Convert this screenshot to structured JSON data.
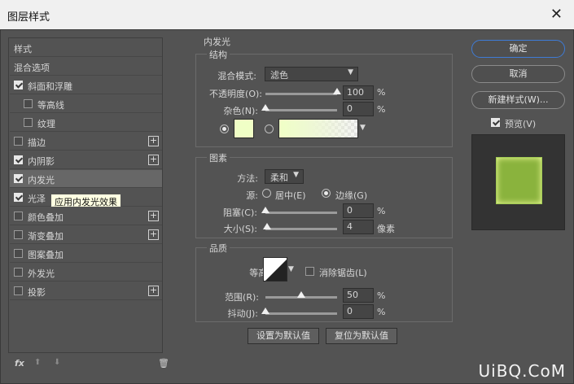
{
  "window": {
    "title": "图层样式",
    "close_glyph": "✕"
  },
  "sidebar": {
    "items": [
      {
        "label": "样式",
        "checkbox": false,
        "checked": false,
        "plus": false,
        "indent": 0,
        "selected": false
      },
      {
        "label": "混合选项",
        "checkbox": false,
        "checked": false,
        "plus": false,
        "indent": 0,
        "selected": false
      },
      {
        "label": "斜面和浮雕",
        "checkbox": true,
        "checked": true,
        "plus": false,
        "indent": 0,
        "selected": false
      },
      {
        "label": "等高线",
        "checkbox": true,
        "checked": false,
        "plus": false,
        "indent": 1,
        "selected": false
      },
      {
        "label": "纹理",
        "checkbox": true,
        "checked": false,
        "plus": false,
        "indent": 1,
        "selected": false
      },
      {
        "label": "描边",
        "checkbox": true,
        "checked": false,
        "plus": true,
        "indent": 0,
        "selected": false
      },
      {
        "label": "内阴影",
        "checkbox": true,
        "checked": true,
        "plus": true,
        "indent": 0,
        "selected": false
      },
      {
        "label": "内发光",
        "checkbox": true,
        "checked": true,
        "plus": false,
        "indent": 0,
        "selected": true
      },
      {
        "label": "光泽",
        "checkbox": true,
        "checked": true,
        "plus": false,
        "indent": 0,
        "selected": false
      },
      {
        "label": "颜色叠加",
        "checkbox": true,
        "checked": false,
        "plus": true,
        "indent": 0,
        "selected": false
      },
      {
        "label": "渐变叠加",
        "checkbox": true,
        "checked": false,
        "plus": true,
        "indent": 0,
        "selected": false
      },
      {
        "label": "图案叠加",
        "checkbox": true,
        "checked": false,
        "plus": false,
        "indent": 0,
        "selected": false
      },
      {
        "label": "外发光",
        "checkbox": true,
        "checked": false,
        "plus": false,
        "indent": 0,
        "selected": false
      },
      {
        "label": "投影",
        "checkbox": true,
        "checked": false,
        "plus": true,
        "indent": 0,
        "selected": false
      }
    ],
    "tooltip": "应用内发光效果",
    "bottom_icons": {
      "fx": "fx",
      "up": "⬆",
      "down": "⬇",
      "trash": "🗑"
    }
  },
  "inner_glow": {
    "section_title": "内发光",
    "structure": {
      "title": "结构",
      "blend_mode_label": "混合模式:",
      "blend_mode_value": "滤色",
      "opacity_label": "不透明度(O):",
      "opacity_value": "100",
      "opacity_level": 1.0,
      "noise_label": "杂色(N):",
      "noise_value": "0",
      "noise_level": 0.0,
      "percent": "%",
      "glow_color": "#f0ffc6"
    },
    "elements": {
      "title": "图素",
      "technique_label": "方法:",
      "technique_value": "柔和",
      "source_label": "源:",
      "source_center": "居中(E)",
      "source_edge": "边缘(G)",
      "choke_label": "阻塞(C):",
      "choke_value": "0",
      "choke_level": 0.0,
      "size_label": "大小(S):",
      "size_value": "4",
      "size_level": 0.02,
      "size_unit": "像素",
      "percent": "%"
    },
    "quality": {
      "title": "品质",
      "contour_label": "等高线:",
      "anti_alias_label": "消除锯齿(L)",
      "range_label": "范围(R):",
      "range_value": "50",
      "range_level": 0.5,
      "jitter_label": "抖动(J):",
      "jitter_value": "0",
      "jitter_level": 0.0,
      "percent": "%"
    },
    "make_default": "设置为默认值",
    "reset_default": "复位为默认值"
  },
  "buttons": {
    "ok": "确定",
    "cancel": "取消",
    "new_style": "新建样式(W)...",
    "preview_label": "预览(V)"
  },
  "watermark": "UiBQ.CoM"
}
